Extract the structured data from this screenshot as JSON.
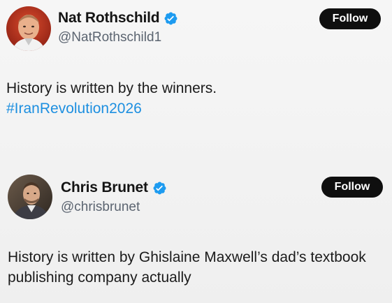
{
  "tweets": [
    {
      "display_name": "Nat Rothschild",
      "handle": "@NatRothschild1",
      "verified_icon": "verified-badge-icon",
      "follow_label": "Follow",
      "text": "History is written by the winners.",
      "hashtag": "#IranRevolution2026"
    },
    {
      "display_name": "Chris Brunet",
      "handle": "@chrisbrunet",
      "verified_icon": "verified-badge-icon",
      "follow_label": "Follow",
      "text": "History is written by Ghislaine Maxwell’s dad’s textbook publishing company actually"
    }
  ],
  "colors": {
    "verified_blue": "#1d9bf0",
    "hashtag_blue": "#1d8fe0",
    "follow_bg": "#0f0f0f",
    "handle_gray": "#5b6470"
  }
}
